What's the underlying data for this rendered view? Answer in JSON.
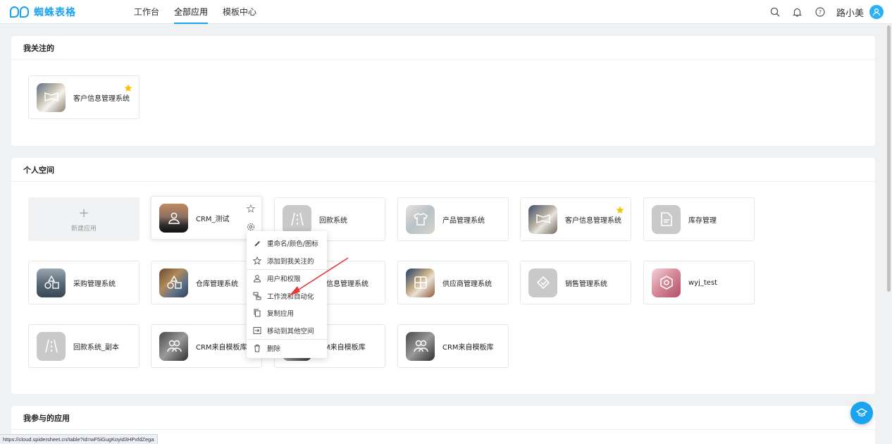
{
  "app": {
    "logo_text": "蜘蛛表格",
    "brand_color": "#1aa3f0"
  },
  "nav": [
    {
      "label": "工作台",
      "active": false
    },
    {
      "label": "全部应用",
      "active": true
    },
    {
      "label": "模板中心",
      "active": false
    }
  ],
  "header": {
    "user_name": "路小美",
    "icons": [
      "search-icon",
      "bell-icon",
      "help-circle-icon",
      "user-avatar-icon"
    ]
  },
  "favorites": {
    "title": "我关注的",
    "apps": [
      {
        "name": "客户信息管理系统",
        "starred": true
      }
    ]
  },
  "personal": {
    "title": "个人空间",
    "new_app_label": "新建应用",
    "apps": [
      {
        "name": "CRM_测试",
        "starred": false
      },
      {
        "name": "回款系统",
        "starred": false
      },
      {
        "name": "产品管理系统",
        "starred": false
      },
      {
        "name": "客户信息管理系统",
        "starred": true
      },
      {
        "name": "库存管理",
        "starred": false
      },
      {
        "name": "采购管理系统",
        "starred": false
      },
      {
        "name": "仓库管理系统",
        "starred": false
      },
      {
        "name": "店信息管理系统",
        "starred": false
      },
      {
        "name": "供应商管理系统",
        "starred": false
      },
      {
        "name": "销售管理系统",
        "starred": false
      },
      {
        "name": "wyj_test",
        "starred": false
      },
      {
        "name": "回款系统_副本",
        "starred": false
      },
      {
        "name": "CRM来自模板库",
        "starred": false
      },
      {
        "name": "RM来自模板库",
        "starred": false
      },
      {
        "name": "CRM来自模板库",
        "starred": false
      }
    ]
  },
  "participating": {
    "title": "我参与的应用"
  },
  "context_menu": {
    "items": [
      {
        "label": "重命名/颜色/图标",
        "icon": "pencil-icon"
      },
      {
        "label": "添加到我关注的",
        "icon": "star-outline-icon"
      },
      {
        "label": "用户和权限",
        "icon": "user-permission-icon"
      },
      {
        "label": "工作流和自动化",
        "icon": "workflow-icon"
      },
      {
        "label": "复制应用",
        "icon": "copy-icon"
      },
      {
        "label": "移动到其他空间",
        "icon": "move-icon"
      },
      {
        "label": "删除",
        "icon": "trash-icon"
      }
    ]
  },
  "status_url": "https://cloud.spidersheet.cn/table?id=wF5iGugKoyid3HPxfdZega"
}
